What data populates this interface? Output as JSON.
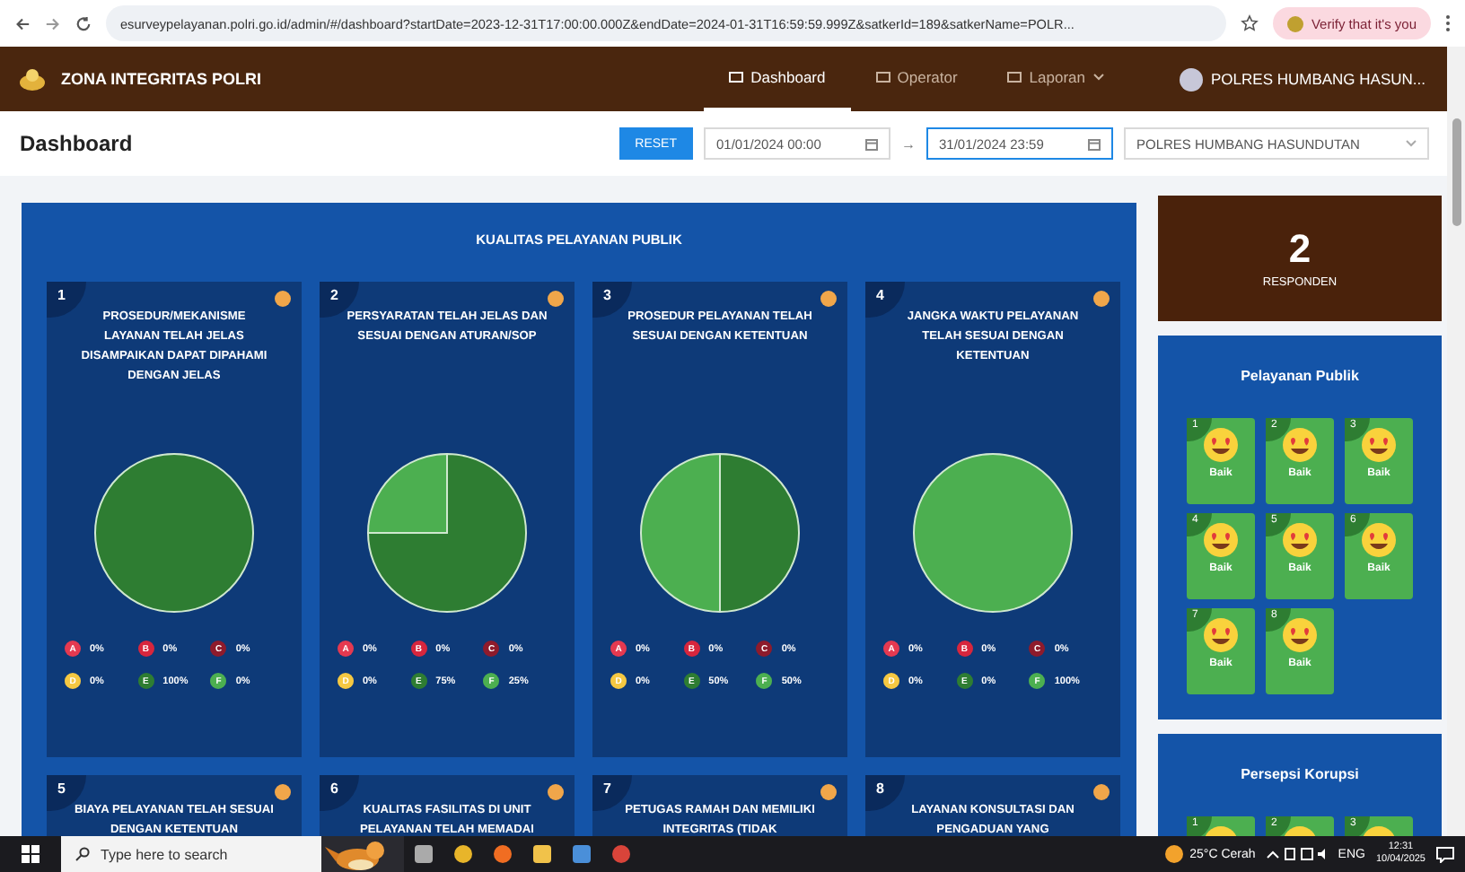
{
  "browser": {
    "url": "esurveypelayanan.polri.go.id/admin/#/dashboard?startDate=2023-12-31T17:00:00.000Z&endDate=2024-01-31T16:59:59.999Z&satkerId=189&satkerName=POLR...",
    "verify_button": "Verify that it's you"
  },
  "navbar": {
    "brand": "ZONA INTEGRITAS POLRI",
    "items": [
      {
        "label": "Dashboard",
        "selected": true,
        "dropdown": false
      },
      {
        "label": "Operator",
        "selected": false,
        "dropdown": false
      },
      {
        "label": "Laporan",
        "selected": false,
        "dropdown": true
      }
    ],
    "user": "POLRES HUMBANG HASUN..."
  },
  "header": {
    "title": "Dashboard",
    "reset": "RESET",
    "start_date": "01/01/2024 00:00",
    "arrow": "→",
    "end_date": "31/01/2024 23:59",
    "unit": "POLRES HUMBANG HASUNDUTAN"
  },
  "quality_panel": {
    "title": "KUALITAS PELAYANAN PUBLIK",
    "cards": [
      {
        "number": "1",
        "title": "PROSEDUR/MEKANISME LAYANAN TELAH JELAS DISAMPAIKAN DAPAT DIPAHAMI DENGAN JELAS",
        "chart_data": {
          "type": "pie",
          "categories": [
            "A",
            "B",
            "C",
            "D",
            "E",
            "F"
          ],
          "colors": [
            "#e53950",
            "#d7263d",
            "#8e1b2c",
            "#f5c842",
            "#2e7d32",
            "#4caf50"
          ],
          "series": [
            {
              "values": [
                0,
                0,
                0,
                0,
                100,
                0
              ]
            }
          ],
          "value_labels": [
            "0%",
            "0%",
            "0%",
            "0%",
            "100%",
            "0%"
          ]
        }
      },
      {
        "number": "2",
        "title": "PERSYARATAN TELAH JELAS DAN SESUAI DENGAN ATURAN/SOP",
        "chart_data": {
          "type": "pie",
          "categories": [
            "A",
            "B",
            "C",
            "D",
            "E",
            "F"
          ],
          "colors": [
            "#e53950",
            "#d7263d",
            "#8e1b2c",
            "#f5c842",
            "#2e7d32",
            "#4caf50"
          ],
          "series": [
            {
              "values": [
                0,
                0,
                0,
                0,
                75,
                25
              ]
            }
          ],
          "value_labels": [
            "0%",
            "0%",
            "0%",
            "0%",
            "75%",
            "25%"
          ]
        }
      },
      {
        "number": "3",
        "title": "PROSEDUR PELAYANAN TELAH SESUAI DENGAN KETENTUAN",
        "chart_data": {
          "type": "pie",
          "categories": [
            "A",
            "B",
            "C",
            "D",
            "E",
            "F"
          ],
          "colors": [
            "#e53950",
            "#d7263d",
            "#8e1b2c",
            "#f5c842",
            "#2e7d32",
            "#4caf50"
          ],
          "series": [
            {
              "values": [
                0,
                0,
                0,
                0,
                50,
                50
              ]
            }
          ],
          "value_labels": [
            "0%",
            "0%",
            "0%",
            "0%",
            "50%",
            "50%"
          ]
        }
      },
      {
        "number": "4",
        "title": "JANGKA WAKTU PELAYANAN TELAH SESUAI DENGAN KETENTUAN",
        "chart_data": {
          "type": "pie",
          "categories": [
            "A",
            "B",
            "C",
            "D",
            "E",
            "F"
          ],
          "colors": [
            "#e53950",
            "#d7263d",
            "#8e1b2c",
            "#f5c842",
            "#2e7d32",
            "#4caf50"
          ],
          "series": [
            {
              "values": [
                0,
                0,
                0,
                0,
                0,
                100
              ]
            }
          ],
          "value_labels": [
            "0%",
            "0%",
            "0%",
            "0%",
            "0%",
            "100%"
          ]
        }
      },
      {
        "number": "5",
        "title": "BIAYA PELAYANAN TELAH SESUAI DENGAN KETENTUAN"
      },
      {
        "number": "6",
        "title": "KUALITAS FASILITAS DI UNIT PELAYANAN TELAH MEMADAI"
      },
      {
        "number": "7",
        "title": "PETUGAS RAMAH DAN MEMILIKI INTEGRITAS (TIDAK"
      },
      {
        "number": "8",
        "title": "LAYANAN KONSULTASI DAN PENGADUAN YANG"
      }
    ]
  },
  "responden": {
    "count": "2",
    "label": "RESPONDEN"
  },
  "sections": [
    {
      "title": "Pelayanan Publik",
      "tiles": [
        {
          "number": "1",
          "label": "Baik"
        },
        {
          "number": "2",
          "label": "Baik"
        },
        {
          "number": "3",
          "label": "Baik"
        },
        {
          "number": "4",
          "label": "Baik"
        },
        {
          "number": "5",
          "label": "Baik"
        },
        {
          "number": "6",
          "label": "Baik"
        },
        {
          "number": "7",
          "label": "Baik"
        },
        {
          "number": "8",
          "label": "Baik"
        }
      ]
    },
    {
      "title": "Persepsi Korupsi",
      "tiles": [
        {
          "number": "1"
        },
        {
          "number": "2"
        },
        {
          "number": "3"
        }
      ]
    }
  ],
  "taskbar": {
    "search_placeholder": "Type here to search",
    "weather": "25°C Cerah",
    "language": "ENG",
    "time": "12:31",
    "date": "10/04/2025"
  }
}
